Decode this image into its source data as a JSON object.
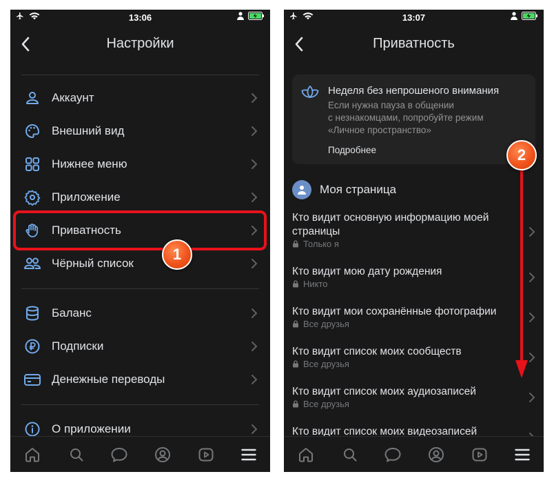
{
  "left": {
    "status": {
      "time": "13:06"
    },
    "title": "Настройки",
    "items": [
      {
        "label": "Аккаунт",
        "icon": "user-icon"
      },
      {
        "label": "Внешний вид",
        "icon": "palette-icon"
      },
      {
        "label": "Нижнее меню",
        "icon": "grid-icon"
      },
      {
        "label": "Приложение",
        "icon": "gear-icon"
      },
      {
        "label": "Приватность",
        "icon": "hand-icon"
      },
      {
        "label": "Чёрный список",
        "icon": "users-icon"
      },
      {
        "label": "Баланс",
        "icon": "database-icon"
      },
      {
        "label": "Подписки",
        "icon": "ruble-icon"
      },
      {
        "label": "Денежные переводы",
        "icon": "card-icon"
      },
      {
        "label": "О приложении",
        "icon": "info-icon"
      }
    ],
    "badge": "1"
  },
  "right": {
    "status": {
      "time": "13:07"
    },
    "title": "Приватность",
    "card": {
      "title": "Неделя без непрошеного внимания",
      "lines": [
        "Если нужна пауза в общении",
        "с незнакомцами, попробуйте режим",
        "«Личное пространство»"
      ],
      "link": "Подробнее"
    },
    "section_title": "Моя страница",
    "rows": [
      {
        "title_lines": [
          "Кто видит основную информацию моей",
          "страницы"
        ],
        "value": "Только я"
      },
      {
        "title_lines": [
          "Кто видит мою дату рождения"
        ],
        "value": "Никто"
      },
      {
        "title_lines": [
          "Кто видит мои сохранённые фотографии"
        ],
        "value": "Все друзья"
      },
      {
        "title_lines": [
          "Кто видит список моих сообществ"
        ],
        "value": "Все друзья"
      },
      {
        "title_lines": [
          "Кто видит список моих аудиозаписей"
        ],
        "value": "Все друзья"
      },
      {
        "title_lines": [
          "Кто видит список моих видеозаписей"
        ],
        "value": ""
      }
    ],
    "badge": "2"
  },
  "tabbar": [
    "home-icon",
    "search-icon",
    "messages-icon",
    "profile-icon",
    "video-icon",
    "menu-icon"
  ],
  "colors": {
    "background": "#19191a",
    "accent": "#71aaeb",
    "highlight": "#e8121a",
    "badge": "#f0541c"
  }
}
